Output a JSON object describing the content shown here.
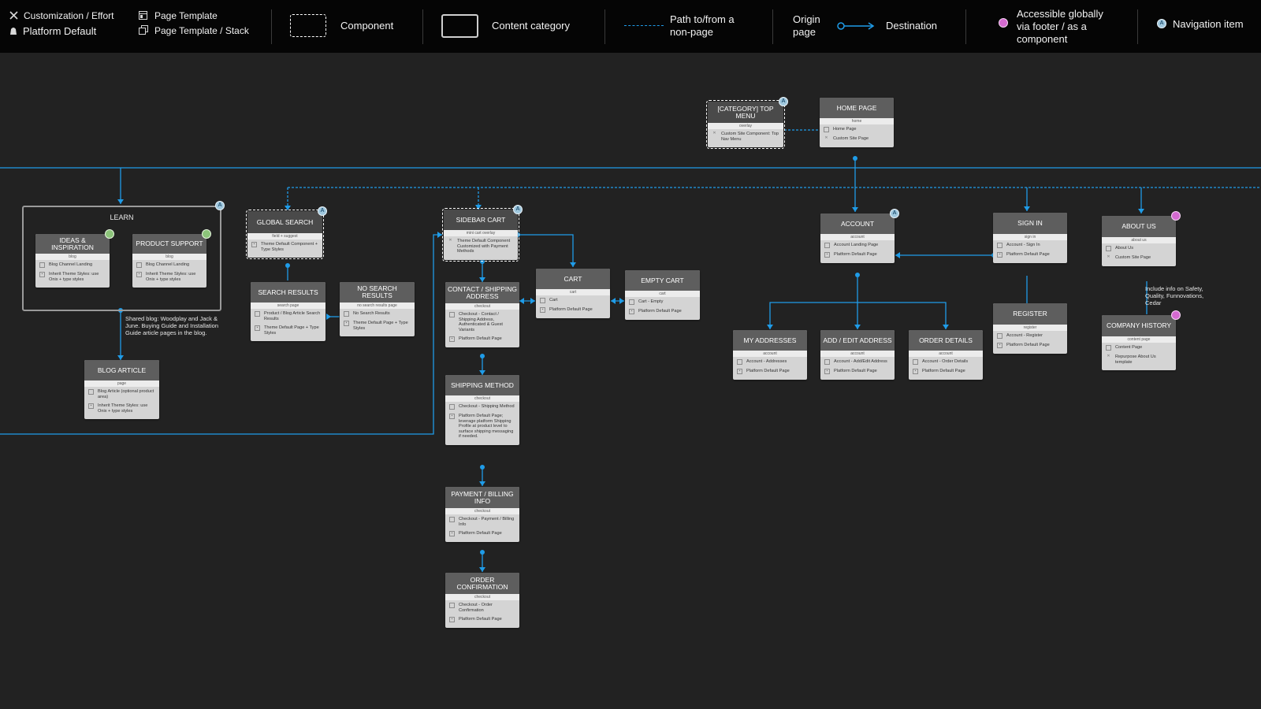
{
  "legend": {
    "customization": "Customization / Effort",
    "platform_default": "Platform Default",
    "page_template": "Page Template",
    "page_template_stack": "Page Template / Stack",
    "component": "Component",
    "content_category": "Content category",
    "path_line1": "Path to/from a",
    "path_line2": "non-page",
    "origin_line1": "Origin",
    "origin_line2": "page",
    "destination": "Destination",
    "global_line1": "Accessible globally",
    "global_line2": "via footer / as a",
    "global_line3": "component",
    "nav_item": "Navigation item",
    "nav_badge": "A"
  },
  "colors": {
    "accent": "#1f9ce8",
    "background": "#222222",
    "legend_bg": "#050505",
    "node_header": "#5e5e5e",
    "node_body": "#d4d4d4"
  },
  "nodes": {
    "top_menu": {
      "title": "[CATEGORY] TOP MENU",
      "sub": "overlay",
      "rows": [
        {
          "icon": "✕",
          "text": "Custom Site Component: Top Nav Menu"
        }
      ]
    },
    "home": {
      "title": "HOME PAGE",
      "sub": "home",
      "rows": [
        {
          "icon": "",
          "text": "Home Page"
        },
        {
          "icon": "✕",
          "text": "Custom Site Page"
        }
      ]
    },
    "learn": {
      "title": "LEARN"
    },
    "ideas": {
      "title": "IDEAS & INSPIRATION",
      "sub": "blog",
      "rows": [
        {
          "icon": "",
          "text": "Blog Channel Landing"
        },
        {
          "icon": "▪",
          "text": "Inherit Theme Styles: use Onix + type styles"
        }
      ]
    },
    "support": {
      "title": "PRODUCT SUPPORT",
      "sub": "blog",
      "rows": [
        {
          "icon": "",
          "text": "Blog Channel Landing"
        },
        {
          "icon": "▪",
          "text": "Inherit Theme Styles: use Onix + type styles"
        }
      ]
    },
    "blog_article": {
      "title": "BLOG ARTICLE",
      "sub": "page",
      "rows": [
        {
          "icon": "",
          "text": "Blog Article (optional product area)"
        },
        {
          "icon": "▪",
          "text": "Inherit Theme Styles: use Onix + type styles"
        }
      ]
    },
    "global_search": {
      "title": "GLOBAL SEARCH",
      "sub": "field + suggest",
      "rows": [
        {
          "icon": "▪",
          "text": "Theme Default Component + Type Styles"
        }
      ]
    },
    "search_results": {
      "title": "SEARCH RESULTS",
      "sub": "search page",
      "rows": [
        {
          "icon": "",
          "text": "Product / Blog Article Search Results"
        },
        {
          "icon": "▪",
          "text": "Theme Default Page + Type Styles"
        }
      ]
    },
    "no_search": {
      "title": "NO SEARCH RESULTS",
      "sub": "no search results page",
      "rows": [
        {
          "icon": "",
          "text": "No Search Results"
        },
        {
          "icon": "▪",
          "text": "Theme Default Page + Type Styles"
        }
      ]
    },
    "sidebar_cart": {
      "title": "SIDEBAR CART",
      "sub": "mini cart overlay",
      "rows": [
        {
          "icon": "✕",
          "text": "Theme Default Component Customized with Payment Methods"
        }
      ]
    },
    "contact": {
      "title": "CONTACT / SHIPPING ADDRESS",
      "sub": "checkout",
      "rows": [
        {
          "icon": "",
          "text": "Checkout - Contact / Shipping Address, Authenticated & Guest Variants"
        },
        {
          "icon": "▪",
          "text": "Platform Default Page"
        }
      ]
    },
    "cart": {
      "title": "CART",
      "sub": "cart",
      "rows": [
        {
          "icon": "",
          "text": "Cart"
        },
        {
          "icon": "▪",
          "text": "Platform Default Page"
        }
      ]
    },
    "empty_cart": {
      "title": "EMPTY CART",
      "sub": "cart",
      "rows": [
        {
          "icon": "",
          "text": "Cart - Empty"
        },
        {
          "icon": "▪",
          "text": "Platform Default Page"
        }
      ]
    },
    "shipping_method": {
      "title": "SHIPPING METHOD",
      "sub": "checkout",
      "rows": [
        {
          "icon": "",
          "text": "Checkout - Shipping Method"
        },
        {
          "icon": "▪",
          "text": "Platform Default Page; leverage platform Shipping Profile at product level to surface shipping messaging if needed."
        }
      ]
    },
    "payment": {
      "title": "PAYMENT / BILLING INFO",
      "sub": "checkout",
      "rows": [
        {
          "icon": "",
          "text": "Checkout - Payment / Billing Info"
        },
        {
          "icon": "▪",
          "text": "Platform Default Page"
        }
      ]
    },
    "order_conf": {
      "title": "ORDER CONFIRMATION",
      "sub": "checkout",
      "rows": [
        {
          "icon": "",
          "text": "Checkout - Order Confirmation"
        },
        {
          "icon": "▪",
          "text": "Platform Default Page"
        }
      ]
    },
    "account": {
      "title": "ACCOUNT",
      "sub": "account",
      "rows": [
        {
          "icon": "",
          "text": "Account Landing Page"
        },
        {
          "icon": "▪",
          "text": "Platform Default Page"
        }
      ]
    },
    "my_addresses": {
      "title": "MY ADDRESSES",
      "sub": "account",
      "rows": [
        {
          "icon": "",
          "text": "Account - Addresses"
        },
        {
          "icon": "▪",
          "text": "Platform Default Page"
        }
      ]
    },
    "add_edit": {
      "title": "ADD / EDIT ADDRESS",
      "sub": "account",
      "rows": [
        {
          "icon": "",
          "text": "Account - Add/Edit Address"
        },
        {
          "icon": "▪",
          "text": "Platform Default Page"
        }
      ]
    },
    "order_details": {
      "title": "ORDER DETAILS",
      "sub": "account",
      "rows": [
        {
          "icon": "",
          "text": "Account - Order Details"
        },
        {
          "icon": "▪",
          "text": "Platform Default Page"
        }
      ]
    },
    "sign_in": {
      "title": "SIGN IN",
      "sub": "sign in",
      "rows": [
        {
          "icon": "",
          "text": "Account - Sign In"
        },
        {
          "icon": "▪",
          "text": "Platform Default Page"
        }
      ]
    },
    "register": {
      "title": "REGISTER",
      "sub": "register",
      "rows": [
        {
          "icon": "",
          "text": "Account - Register"
        },
        {
          "icon": "▪",
          "text": "Platform Default Page"
        }
      ]
    },
    "about": {
      "title": "ABOUT US",
      "sub": "about us",
      "rows": [
        {
          "icon": "",
          "text": "About Us"
        },
        {
          "icon": "✕",
          "text": "Custom Site Page"
        }
      ]
    },
    "company_history": {
      "title": "COMPANY HISTORY",
      "sub": "content page",
      "rows": [
        {
          "icon": "",
          "text": "Content Page"
        },
        {
          "icon": "✕",
          "text": "Repurpose About Us template"
        }
      ]
    }
  },
  "notes": {
    "blog": "Shared blog: Woodplay and Jack & June. Buying Guide and Installation Guide article pages in the blog.",
    "about": "Include info on Safety, Quality, Funnovations, Cedar"
  }
}
